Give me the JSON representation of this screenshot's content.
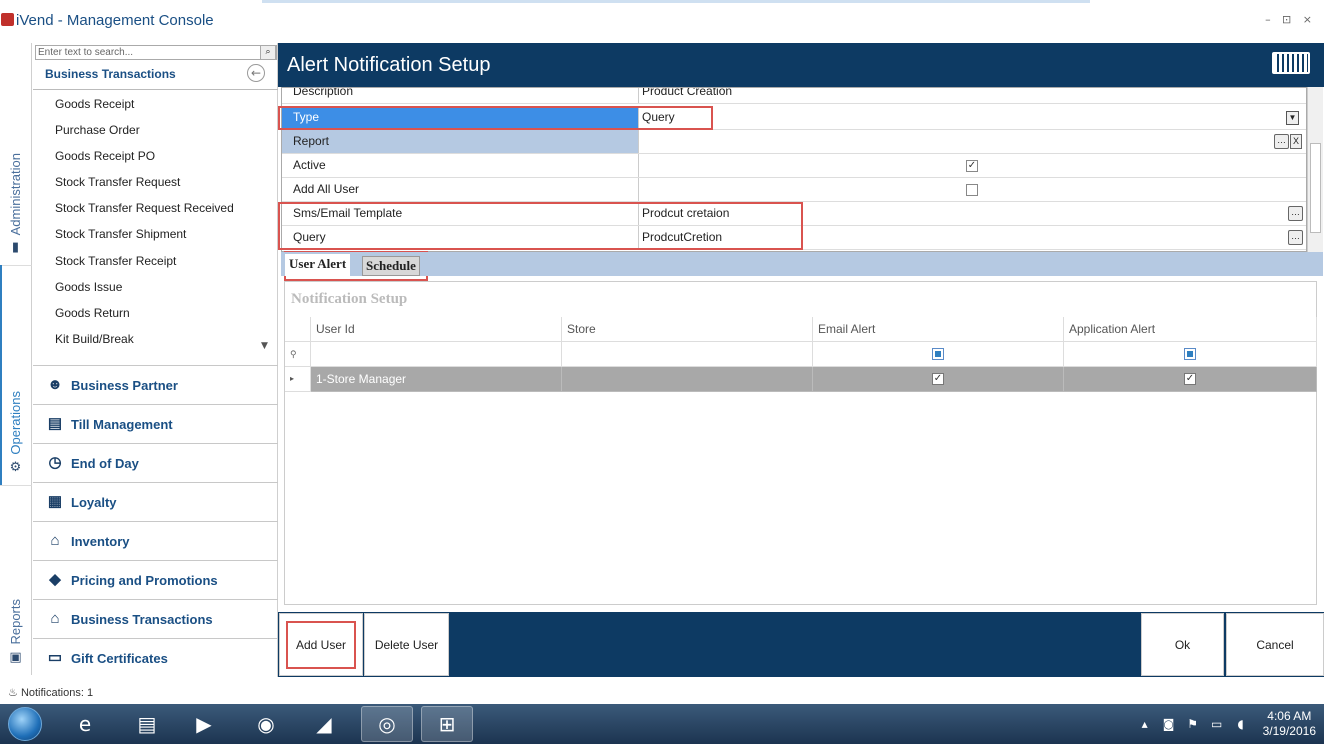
{
  "window": {
    "title": "iVend - Management Console",
    "controls": "– ⊡ ×"
  },
  "side_tabs": {
    "administration": "Administration",
    "operations": "Operations",
    "reports": "Reports"
  },
  "sidebar": {
    "search_placeholder": "Enter text to search...",
    "header": "Business Transactions",
    "items": [
      "Goods Receipt",
      "Purchase Order",
      "Goods Receipt PO",
      "Stock Transfer Request",
      "Stock Transfer Request Received",
      "Stock Transfer Shipment",
      "Stock Transfer Receipt",
      "Goods Issue",
      "Goods Return",
      "Kit Build/Break"
    ],
    "groups": [
      {
        "label": "Business Partner",
        "icon": "person-icon"
      },
      {
        "label": "Till Management",
        "icon": "register-icon"
      },
      {
        "label": "End of Day",
        "icon": "clock-icon"
      },
      {
        "label": "Loyalty",
        "icon": "gift-icon"
      },
      {
        "label": "Inventory",
        "icon": "warehouse-icon"
      },
      {
        "label": "Pricing and Promotions",
        "icon": "tag-icon"
      },
      {
        "label": "Business Transactions",
        "icon": "store-icon"
      },
      {
        "label": "Gift Certificates",
        "icon": "certificate-icon"
      }
    ]
  },
  "main": {
    "title": "Alert Notification Setup"
  },
  "props": {
    "description": {
      "label": "Description",
      "value": "Product Creation"
    },
    "type": {
      "label": "Type",
      "value": "Query"
    },
    "report": {
      "label": "Report",
      "value": ""
    },
    "active": {
      "label": "Active",
      "checked": true
    },
    "add_all_user": {
      "label": "Add All User",
      "checked": false
    },
    "template": {
      "label": "Sms/Email Template",
      "value": "Prodcut cretaion"
    },
    "query": {
      "label": "Query",
      "value": "ProdcutCretion"
    }
  },
  "tabs": {
    "user_alert": "User Alert",
    "schedule": "Schedule"
  },
  "notification": {
    "title": "Notification Setup",
    "columns": [
      "User Id",
      "Store",
      "Email Alert",
      "Application Alert"
    ],
    "rows": [
      {
        "user_id": "1-Store Manager",
        "store": "",
        "email_alert": true,
        "application_alert": true
      }
    ]
  },
  "buttons": {
    "add_user": "Add User",
    "delete_user": "Delete User",
    "ok": "Ok",
    "cancel": "Cancel"
  },
  "status": {
    "notifications": "Notifications: 1"
  },
  "taskbar": {
    "time": "4:06 AM",
    "date": "3/19/2016"
  },
  "colors": {
    "header": "#0d3a63",
    "highlight": "#d9534f",
    "selected_row": "#3d8ee6"
  }
}
